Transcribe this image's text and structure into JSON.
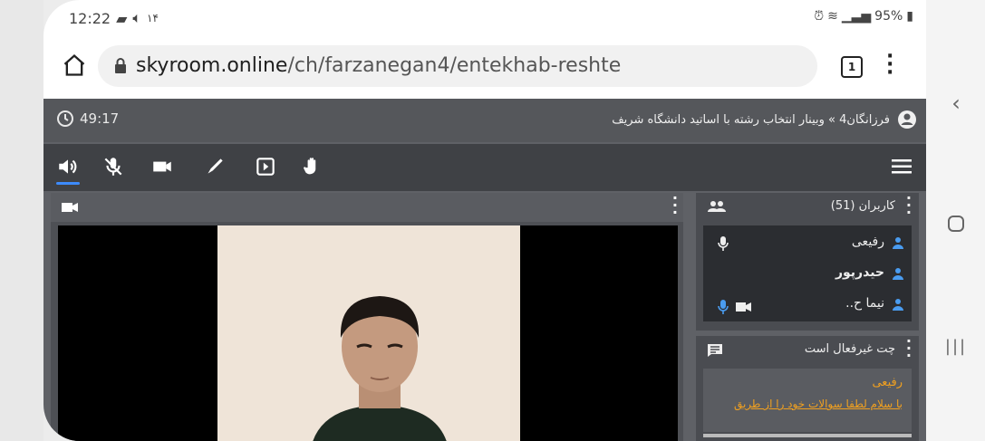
{
  "statusbar": {
    "time": "12:22",
    "left_extra": "۱۴",
    "battery": "95%"
  },
  "browser": {
    "url_host": "skyroom.online",
    "url_path": "/ch/farzanegan4/entekhab-reshte",
    "tab_count": "1"
  },
  "room": {
    "timer": "49:17",
    "title": "فرزانگان4 » وبینار انتخاب رشته با اساتید دانشگاه شریف"
  },
  "toolbar": {
    "icons": [
      "speaker-icon",
      "mic-off-icon",
      "camera-icon",
      "pen-icon",
      "screen-share-icon",
      "raise-hand-icon",
      "menu-icon"
    ]
  },
  "users": {
    "header": "کاربران (51)",
    "list": [
      {
        "name": "رفیعی"
      },
      {
        "name": "حیدرپور"
      },
      {
        "name": "نیما ح.."
      }
    ]
  },
  "chat": {
    "header": "چت غیرفعال است",
    "sender": "رفیعی",
    "message": "با سلام لطفا سوالات خود را از طریق"
  },
  "colors": {
    "accent": "#3d8bfd",
    "chat_text": "#f0a020"
  }
}
